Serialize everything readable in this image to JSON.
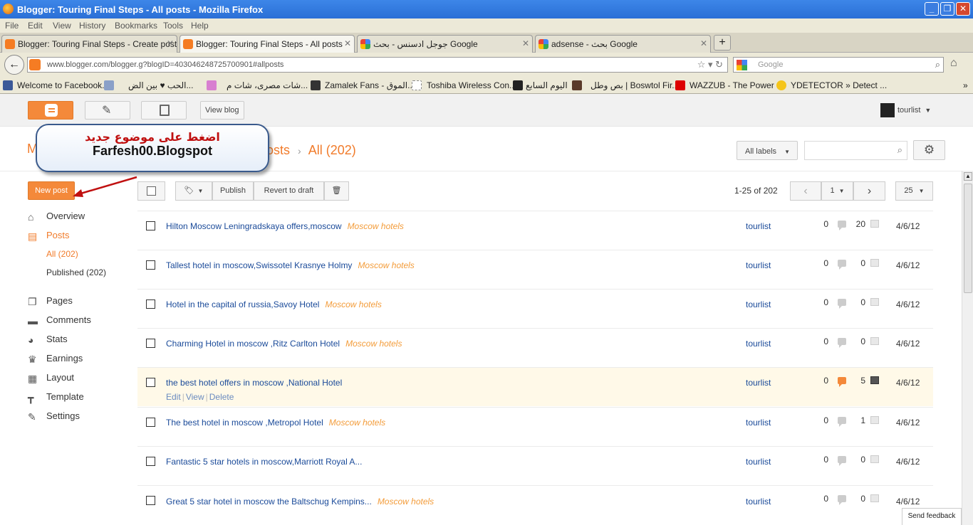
{
  "window": {
    "title": "Blogger: Touring Final Steps - All posts - Mozilla Firefox"
  },
  "menu": [
    "File",
    "Edit",
    "View",
    "History",
    "Bookmarks",
    "Tools",
    "Help"
  ],
  "tabs": [
    {
      "label": "Blogger: Touring Final Steps - Create post"
    },
    {
      "label": "Blogger: Touring Final Steps - All posts"
    },
    {
      "label": "جوجل ادسنس - بحث Google"
    },
    {
      "label": "adsense - بحث Google"
    }
  ],
  "address": {
    "url": "www.blogger.com/blogger.g?blogID=403046248725700901#allposts"
  },
  "search": {
    "placeholder": "Google"
  },
  "bookmarks": [
    "Welcome to Facebook...",
    "الحب ♥ بين الض...",
    "شات مصرى، شات م...",
    "Zamalek Fans - الموق...",
    "Toshiba Wireless Con...",
    "اليوم السابع",
    "بص وطل | Boswtol Fir...",
    "WAZZUB - The Power ...",
    "YDETECTOR » Detect ..."
  ],
  "header": {
    "view_blog": "View blog",
    "user": "tourlist"
  },
  "breadcrumb": {
    "left": "M",
    "posts": "osts",
    "sep": "›",
    "all": "All (202)"
  },
  "callout": {
    "arabic": "اضغط على موضوع جديد",
    "english": "Farfesh00.Blogspot"
  },
  "toolbar": {
    "new_post": "New post",
    "publish": "Publish",
    "revert": "Revert to draft",
    "labels": "All labels"
  },
  "pagination": {
    "range": "1-25 of 202",
    "page": "1",
    "per_page": "25"
  },
  "sidebar": {
    "overview": "Overview",
    "posts": "Posts",
    "all": "All (202)",
    "published": "Published (202)",
    "pages": "Pages",
    "comments": "Comments",
    "stats": "Stats",
    "earnings": "Earnings",
    "layout": "Layout",
    "template": "Template",
    "settings": "Settings"
  },
  "posts": [
    {
      "title": "Hilton Moscow Leningradskaya offers,moscow",
      "label": "Moscow hotels",
      "author": "tourlist",
      "comments": "0",
      "views": "20",
      "date": "4/6/12",
      "highlighted": false
    },
    {
      "title": "Tallest hotel in moscow,Swissotel Krasnye Holmy",
      "label": "Moscow hotels",
      "author": "tourlist",
      "comments": "0",
      "views": "0",
      "date": "4/6/12",
      "highlighted": false
    },
    {
      "title": "Hotel in the capital of russia,Savoy Hotel",
      "label": "Moscow hotels",
      "author": "tourlist",
      "comments": "0",
      "views": "0",
      "date": "4/6/12",
      "highlighted": false
    },
    {
      "title": "Charming Hotel in moscow ,Ritz Carlton Hotel",
      "label": "Moscow hotels",
      "author": "tourlist",
      "comments": "0",
      "views": "0",
      "date": "4/6/12",
      "highlighted": false
    },
    {
      "title": "the best hotel offers in moscow ,National Hotel",
      "label": "",
      "author": "tourlist",
      "comments": "0",
      "views": "5",
      "date": "4/6/12",
      "highlighted": true
    },
    {
      "title": "The best hotel in moscow ,Metropol Hotel",
      "label": "Moscow hotels",
      "author": "tourlist",
      "comments": "0",
      "views": "1",
      "date": "4/6/12",
      "highlighted": false
    },
    {
      "title": "Fantastic 5 star hotels in moscow,Marriott Royal A...",
      "label": "",
      "author": "tourlist",
      "comments": "0",
      "views": "0",
      "date": "4/6/12",
      "highlighted": false
    },
    {
      "title": "Great 5 star hotel in moscow the Baltschug Kempins...",
      "label": "Moscow hotels",
      "author": "tourlist",
      "comments": "0",
      "views": "0",
      "date": "4/6/12",
      "highlighted": false
    }
  ],
  "row_actions": {
    "edit": "Edit",
    "view": "View",
    "delete": "Delete"
  },
  "feedback": "Send feedback",
  "colors": {
    "accent": "#f4893a",
    "link": "#1a4a99",
    "label": "#f39c3a",
    "highlight_row": "#fff9e8"
  }
}
